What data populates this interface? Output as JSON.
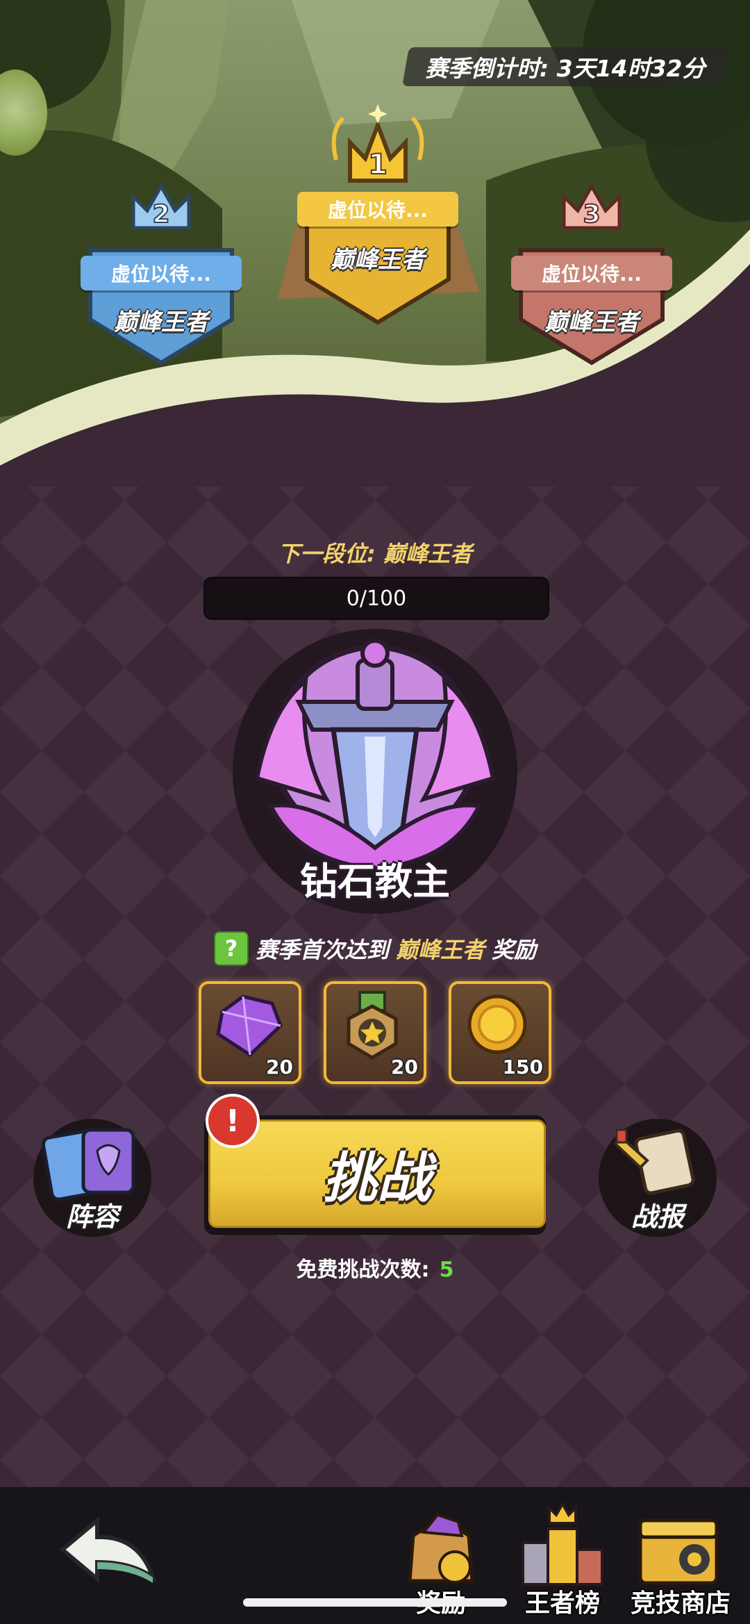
{
  "header": {
    "season_countdown": "赛季倒计时: 3天14时32分"
  },
  "podium": [
    {
      "rank": "1",
      "placeholder": "虚位以待...",
      "title": "巅峰王者",
      "color": "#f0c23a"
    },
    {
      "rank": "2",
      "placeholder": "虚位以待...",
      "title": "巅峰王者",
      "color": "#6aaee6"
    },
    {
      "rank": "3",
      "placeholder": "虚位以待...",
      "title": "巅峰王者",
      "color": "#c9796e"
    }
  ],
  "progress": {
    "next_label": "下一段位:",
    "next_value": "巅峰王者",
    "text": "0/100",
    "current": 0,
    "max": 100
  },
  "current_rank": {
    "name": "钻石教主",
    "icon": "diamond-sword-emblem-icon"
  },
  "rewards": {
    "title_prefix": "赛季首次达到",
    "title_highlight": "巅峰王者",
    "title_suffix": "奖励",
    "help_glyph": "?",
    "items": [
      {
        "icon": "purple-gem-icon",
        "count": "20"
      },
      {
        "icon": "star-medal-icon",
        "count": "20"
      },
      {
        "icon": "gold-coin-icon",
        "count": "150"
      }
    ]
  },
  "actions": {
    "lineup_label": "阵容",
    "challenge_label": "挑战",
    "alert_glyph": "!",
    "report_label": "战报",
    "free_label": "免费挑战次数:",
    "free_count": "5"
  },
  "bottom_nav": [
    {
      "label": "奖励",
      "icon": "reward-bag-icon"
    },
    {
      "label": "王者榜",
      "icon": "king-ranking-icon"
    },
    {
      "label": "竞技商店",
      "icon": "arena-shop-icon"
    }
  ],
  "colors": {
    "accent_gold": "#f3d36b",
    "free_count": "#6ddc4a",
    "bg": "#3a2634"
  }
}
